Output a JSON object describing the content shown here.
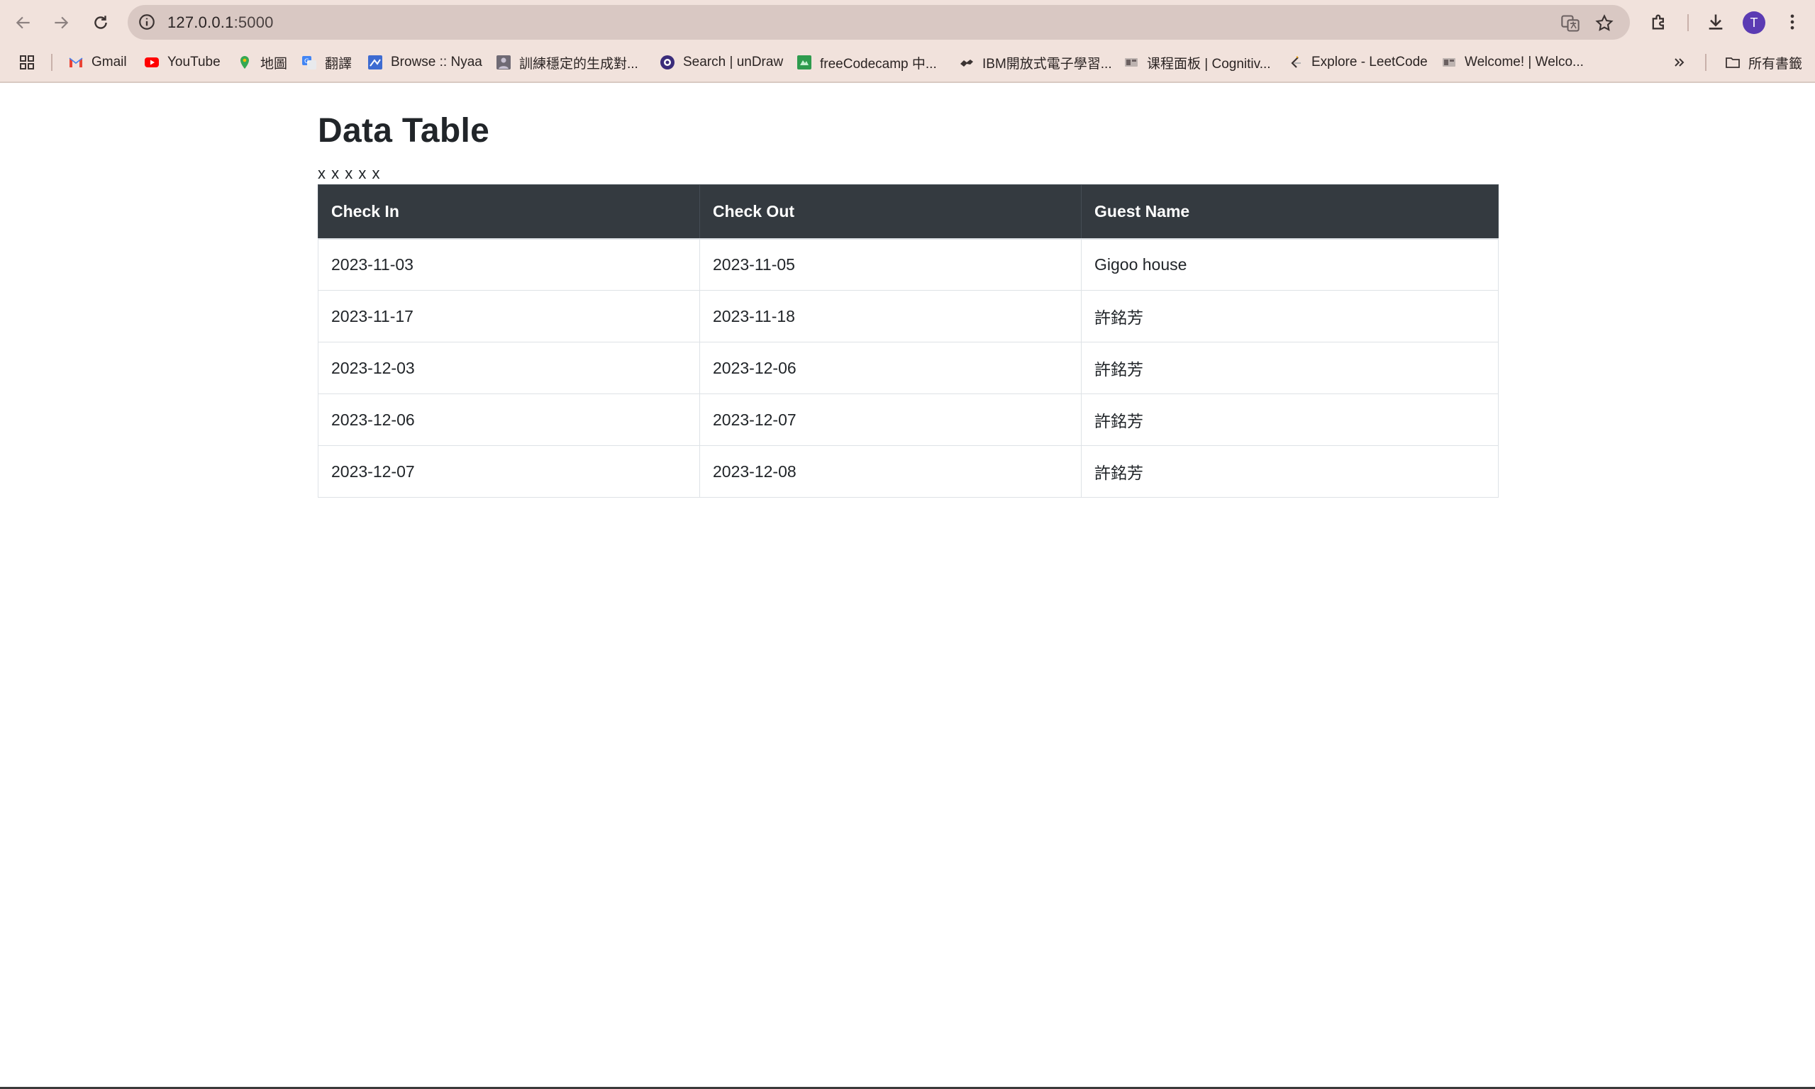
{
  "browser": {
    "url_host": "127.0.0.1",
    "url_port": ":5000",
    "avatar_initial": "T",
    "accent_color": "#5b3bb3",
    "bookmarks": [
      {
        "label": "Gmail",
        "icon": "gmail-icon"
      },
      {
        "label": "YouTube",
        "icon": "youtube-icon"
      },
      {
        "label": "地圖",
        "icon": "maps-icon"
      },
      {
        "label": "翻譯",
        "icon": "translate-icon"
      },
      {
        "label": "Browse :: Nyaa",
        "icon": "nyaa-icon"
      },
      {
        "label": "訓練穩定的生成對...",
        "icon": "article-icon"
      },
      {
        "label": "Search | unDraw",
        "icon": "undraw-icon"
      },
      {
        "label": "freeCodecamp 中...",
        "icon": "freecodecamp-icon"
      },
      {
        "label": "IBM開放式電子學習...",
        "icon": "ibm-icon"
      },
      {
        "label": "课程面板 | Cognitiv...",
        "icon": "cognitive-icon"
      },
      {
        "label": "Explore - LeetCode",
        "icon": "leetcode-icon"
      },
      {
        "label": "Welcome! | Welco...",
        "icon": "welcome-icon"
      }
    ],
    "all_bookmarks_label": "所有書籤"
  },
  "page": {
    "title": "Data Table",
    "subline": "x x x x x"
  },
  "table": {
    "headers": [
      "Check In",
      "Check Out",
      "Guest Name"
    ],
    "header_color": "#343a40",
    "rows": [
      [
        "2023-11-03",
        "2023-11-05",
        "Gigoo house"
      ],
      [
        "2023-11-17",
        "2023-11-18",
        "許銘芳"
      ],
      [
        "2023-12-03",
        "2023-12-06",
        "許銘芳"
      ],
      [
        "2023-12-06",
        "2023-12-07",
        "許銘芳"
      ],
      [
        "2023-12-07",
        "2023-12-08",
        "許銘芳"
      ]
    ]
  }
}
